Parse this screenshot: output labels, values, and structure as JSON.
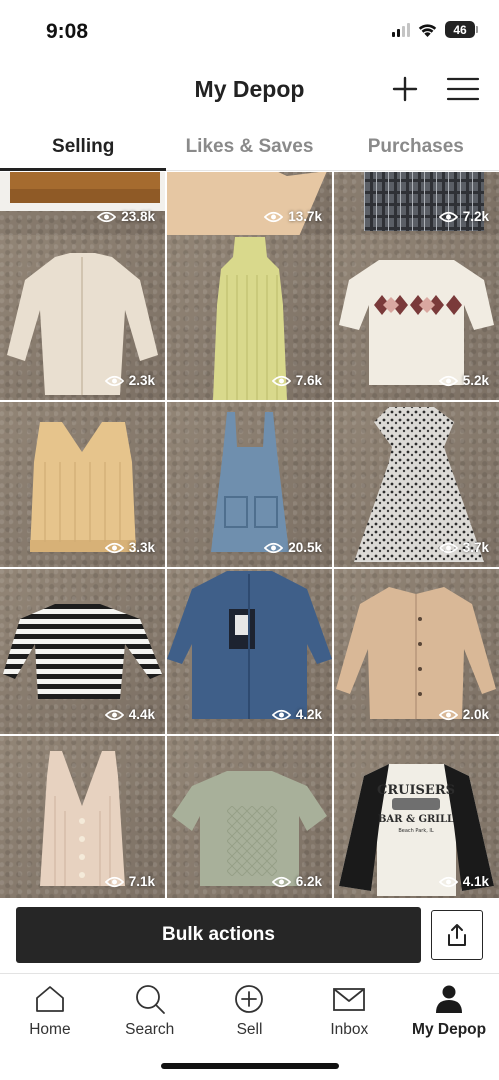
{
  "status_bar": {
    "time": "9:08",
    "battery": "46"
  },
  "header": {
    "title": "My Depop",
    "add_icon": "plus-icon",
    "menu_icon": "hamburger-menu-icon"
  },
  "tabs": [
    {
      "label": "Selling",
      "active": true
    },
    {
      "label": "Likes & Saves",
      "active": false
    },
    {
      "label": "Purchases",
      "active": false
    }
  ],
  "listings": [
    {
      "item": "brown sweater",
      "views": "23.8k"
    },
    {
      "item": "beige cardboard item",
      "views": "13.7k"
    },
    {
      "item": "plaid shirt",
      "views": "7.2k"
    },
    {
      "item": "cream button-up shirt",
      "views": "2.3k"
    },
    {
      "item": "yellow ribbed turtleneck dress",
      "views": "7.6k"
    },
    {
      "item": "argyle knit top",
      "views": "5.2k"
    },
    {
      "item": "tan cable knit vest",
      "views": "3.3k"
    },
    {
      "item": "denim overall dress",
      "views": "20.5k"
    },
    {
      "item": "floral print maxi dress",
      "views": "3.7k"
    },
    {
      "item": "striped long sleeve top",
      "views": "4.4k"
    },
    {
      "item": "denim jacket",
      "views": "4.2k"
    },
    {
      "item": "tan silky blouse",
      "views": "2.0k"
    },
    {
      "item": "pink knit vest",
      "views": "7.1k"
    },
    {
      "item": "sage green knit tee",
      "views": "6.2k"
    },
    {
      "item": "Cruisers Bar & Grill raglan tee",
      "views": "4.1k"
    }
  ],
  "actions": {
    "bulk_label": "Bulk actions",
    "share_icon": "share-icon"
  },
  "bottom_nav": [
    {
      "label": "Home",
      "icon": "home-icon",
      "active": false
    },
    {
      "label": "Search",
      "icon": "search-icon",
      "active": false
    },
    {
      "label": "Sell",
      "icon": "sell-icon",
      "active": false
    },
    {
      "label": "Inbox",
      "icon": "inbox-icon",
      "active": false
    },
    {
      "label": "My Depop",
      "icon": "profile-icon",
      "active": true
    }
  ],
  "garment_print": {
    "line1": "CRUISERS",
    "line2": "BAR & GRILL",
    "line3": "Beach Park, IL"
  },
  "colors": {
    "primary": "#262626",
    "inactive_tab": "#8a8a8a"
  }
}
